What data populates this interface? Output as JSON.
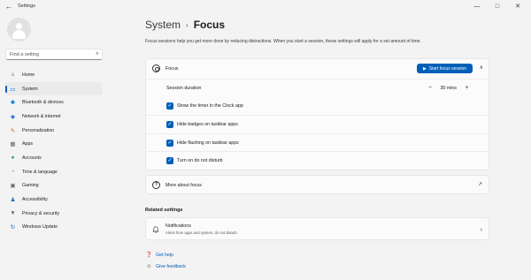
{
  "window": {
    "title": "Settings",
    "back_glyph": "←",
    "minimize_glyph": "—",
    "maximize_glyph": "□",
    "close_glyph": "✕"
  },
  "search": {
    "placeholder": "Find a setting",
    "icon": "search-icon",
    "icon_glyph": "⌕"
  },
  "sidebar": {
    "items": [
      {
        "label": "Home",
        "icon": "home-icon",
        "glyph": "⌂",
        "color": "#3a3a3a"
      },
      {
        "label": "System",
        "icon": "system-icon",
        "glyph": "▭",
        "color": "#0067c0",
        "active": true
      },
      {
        "label": "Bluetooth & devices",
        "icon": "bluetooth-icon",
        "glyph": "✱",
        "color": "#0078d4"
      },
      {
        "label": "Network & internet",
        "icon": "network-icon",
        "glyph": "◆",
        "color": "#2a7de1"
      },
      {
        "label": "Personalization",
        "icon": "personalization-icon",
        "glyph": "✎",
        "color": "#c46b2a"
      },
      {
        "label": "Apps",
        "icon": "apps-icon",
        "glyph": "▦",
        "color": "#5a6a7a"
      },
      {
        "label": "Accounts",
        "icon": "accounts-icon",
        "glyph": "●",
        "color": "#1f9d6b"
      },
      {
        "label": "Time & language",
        "icon": "time-language-icon",
        "glyph": "◔",
        "color": "#1d7fc9"
      },
      {
        "label": "Gaming",
        "icon": "gaming-icon",
        "glyph": "▣",
        "color": "#6a6a6a"
      },
      {
        "label": "Accessibility",
        "icon": "accessibility-icon",
        "glyph": "♟",
        "color": "#1a6fc4"
      },
      {
        "label": "Privacy & security",
        "icon": "shield-icon",
        "glyph": "▼",
        "color": "#6a6a6a"
      },
      {
        "label": "Windows Update",
        "icon": "windows-update-icon",
        "glyph": "↻",
        "color": "#0b6fc8"
      }
    ]
  },
  "breadcrumb": {
    "parent": "System",
    "separator": "›",
    "current": "Focus"
  },
  "description": "Focus sessions help you get more done by reducing distractions. When you start a session, these settings will apply for a set amount of time.",
  "focus_card": {
    "title": "Focus",
    "start_button": "Start focus session",
    "start_button_glyph": "▶",
    "collapse_glyph": "∧",
    "duration_label": "Session duration",
    "duration_value": "30 mins",
    "minus_glyph": "−",
    "plus_glyph": "+",
    "check_glyph": "✓",
    "options": [
      {
        "label": "Show the timer in the Clock app",
        "checked": true
      },
      {
        "label": "Hide badges on taskbar apps",
        "checked": true
      },
      {
        "label": "Hide flashing on taskbar apps",
        "checked": true
      },
      {
        "label": "Turn on do not disturb",
        "checked": true
      }
    ]
  },
  "more_card": {
    "label": "More about focus",
    "icon_glyph": "?",
    "ext_glyph": "↗"
  },
  "related": {
    "title": "Related settings",
    "notifications_title": "Notifications",
    "notifications_sub": "Alerts from apps and system, do not disturb",
    "chevron_glyph": "›"
  },
  "links": {
    "help": "Get help",
    "help_glyph": "❓",
    "feedback": "Give feedback",
    "feedback_glyph": "☺"
  },
  "colors": {
    "accent": "#005fb8",
    "background": "#f3f3f3",
    "card": "#fbfbfb"
  }
}
